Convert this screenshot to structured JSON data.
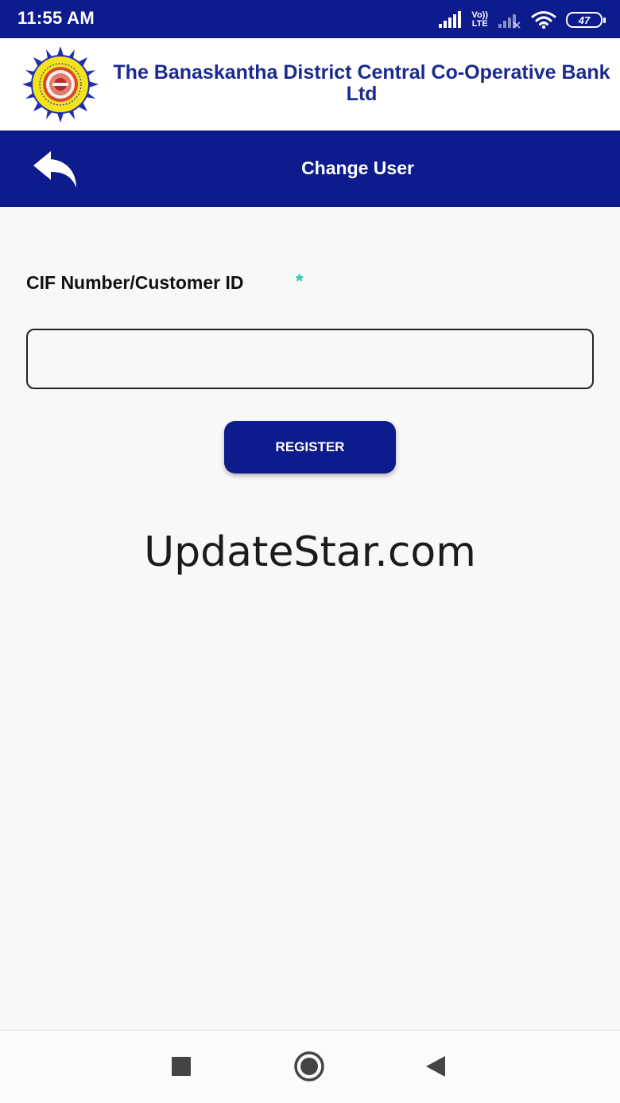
{
  "status_bar": {
    "time": "11:55 AM",
    "volte_top": "Vo))",
    "volte_bottom": "LTE",
    "battery_level": "47"
  },
  "bank": {
    "name": "The Banaskantha District Central Co-Operative Bank Ltd",
    "logo_icon": "bank-emblem-logo"
  },
  "title_bar": {
    "title": "Change User",
    "back_icon": "reply-back-arrow-icon"
  },
  "form": {
    "label": "CIF Number/Customer ID",
    "required_marker": "*",
    "input_value": "",
    "input_placeholder": "",
    "register_label": "REGISTER"
  },
  "watermark": "UpdateStar.com",
  "nav_bar": {
    "buttons": [
      "recents-square-icon",
      "home-circle-icon",
      "back-triangle-icon"
    ]
  },
  "colors": {
    "primary": "#0d1b8c",
    "bank_name_text": "#1a2a8e",
    "required_marker": "#1cc4c0",
    "background": "#f8f8f9"
  }
}
